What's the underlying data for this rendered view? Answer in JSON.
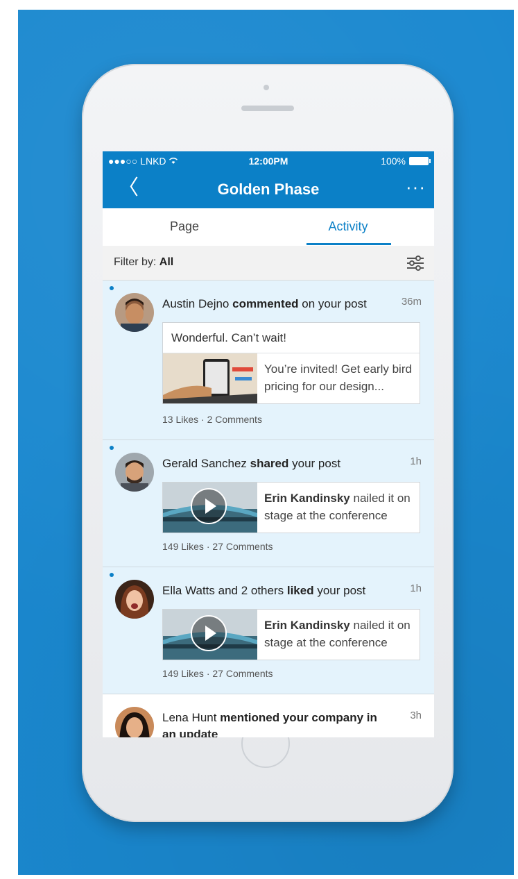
{
  "status_bar": {
    "carrier": "●●●○○ LNKD",
    "time": "12:00PM",
    "battery": "100%"
  },
  "nav": {
    "back_glyph": "〈",
    "title": "Golden Phase",
    "more_glyph": "···"
  },
  "tabs": [
    {
      "label": "Page"
    },
    {
      "label": "Activity"
    }
  ],
  "filter": {
    "prefix": "Filter by:",
    "value": "All"
  },
  "feed": [
    {
      "actor": "Austin Dejno",
      "action": "commented",
      "suffix": "on your post",
      "time": "36m",
      "comment": "Wonderful. Can’t wait!",
      "card_text": "You’re invited! Get early bird pricing for our design...",
      "stats": "13 Likes · 2 Comments"
    },
    {
      "actor": "Gerald Sanchez",
      "action": "shared",
      "suffix": "your post",
      "time": "1h",
      "card_author": "Erin Kandinsky",
      "card_text": "nailed it on stage at the conference",
      "stats": "149 Likes · 27 Comments"
    },
    {
      "actor": "Ella Watts and 2 others",
      "action": "liked",
      "suffix": "your post",
      "time": "1h",
      "card_author": "Erin Kandinsky",
      "card_text": "nailed it on stage at the conference",
      "stats": "149 Likes · 27 Comments"
    },
    {
      "actor": "Lena Hunt",
      "action": "mentioned your company in an update",
      "time": "3h"
    }
  ],
  "colors": {
    "brand_blue": "#0b80c7",
    "background_blue": "#1a88cf",
    "unread_bg": "#e4f3fc"
  },
  "icons": [
    "back-chevron-icon",
    "more-dots-icon",
    "filter-sliders-icon",
    "play-icon",
    "wifi-icon",
    "battery-icon"
  ]
}
